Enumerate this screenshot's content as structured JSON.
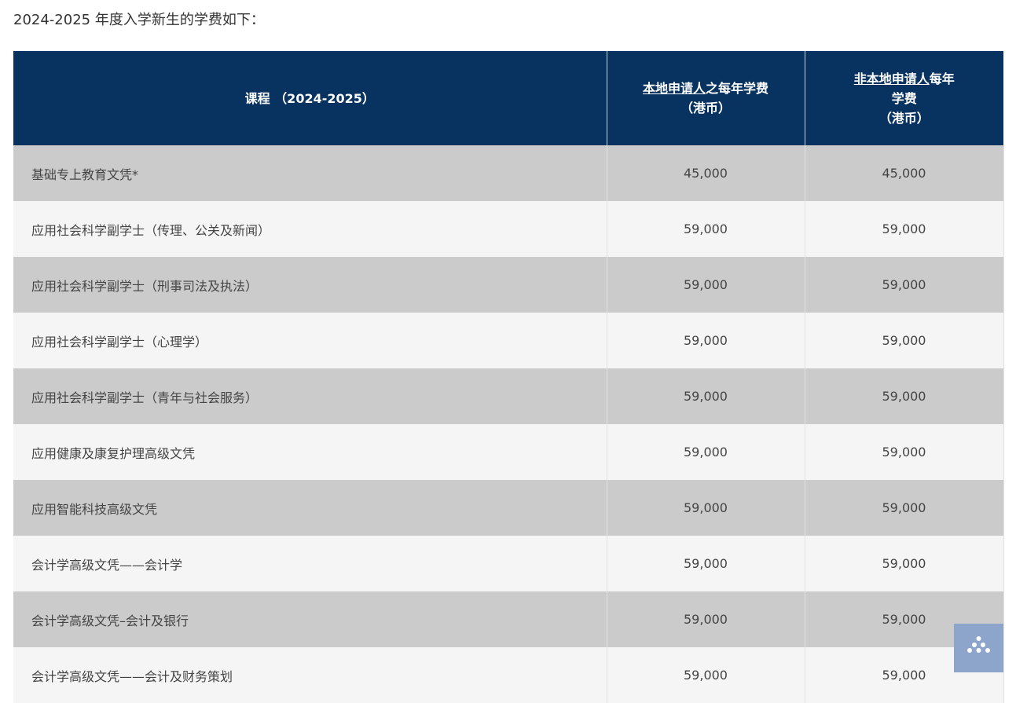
{
  "intro": "2024-2025 年度入学新生的学费如下：",
  "table": {
    "headers": {
      "course": "课程 （2024-2025）",
      "local_underlined": "本地申请人",
      "local_rest": "之每年学费",
      "local_unit": "（港币）",
      "nonlocal_underlined": "非本地申请人",
      "nonlocal_rest": "每年",
      "nonlocal_line2": "学费",
      "nonlocal_unit": "（港币）"
    },
    "rows": [
      {
        "course": "基础专上教育文凭*",
        "local": "45,000",
        "nonlocal": "45,000"
      },
      {
        "course": "应用社会科学副学士（传理、公关及新闻）",
        "local": "59,000",
        "nonlocal": "59,000"
      },
      {
        "course": "应用社会科学副学士（刑事司法及执法）",
        "local": "59,000",
        "nonlocal": "59,000"
      },
      {
        "course": "应用社会科学副学士（心理学）",
        "local": "59,000",
        "nonlocal": "59,000"
      },
      {
        "course": "应用社会科学副学士（青年与社会服务）",
        "local": "59,000",
        "nonlocal": "59,000"
      },
      {
        "course": "应用健康及康复护理高级文凭",
        "local": "59,000",
        "nonlocal": "59,000"
      },
      {
        "course": "应用智能科技高级文凭",
        "local": "59,000",
        "nonlocal": "59,000"
      },
      {
        "course": "会计学高级文凭——会计学",
        "local": "59,000",
        "nonlocal": "59,000"
      },
      {
        "course": "会计学高级文凭–会计及银行",
        "local": "59,000",
        "nonlocal": "59,000"
      },
      {
        "course": "会计学高级文凭——会计及财务策划",
        "local": "59,000",
        "nonlocal": "59,000"
      }
    ]
  },
  "floating_button": {
    "icon": "dots-menu-icon"
  },
  "colors": {
    "header_bg": "#083360",
    "row_dark": "#cbcbcb",
    "row_light": "#f5f5f5",
    "button_bg": "#8ea5cb"
  }
}
